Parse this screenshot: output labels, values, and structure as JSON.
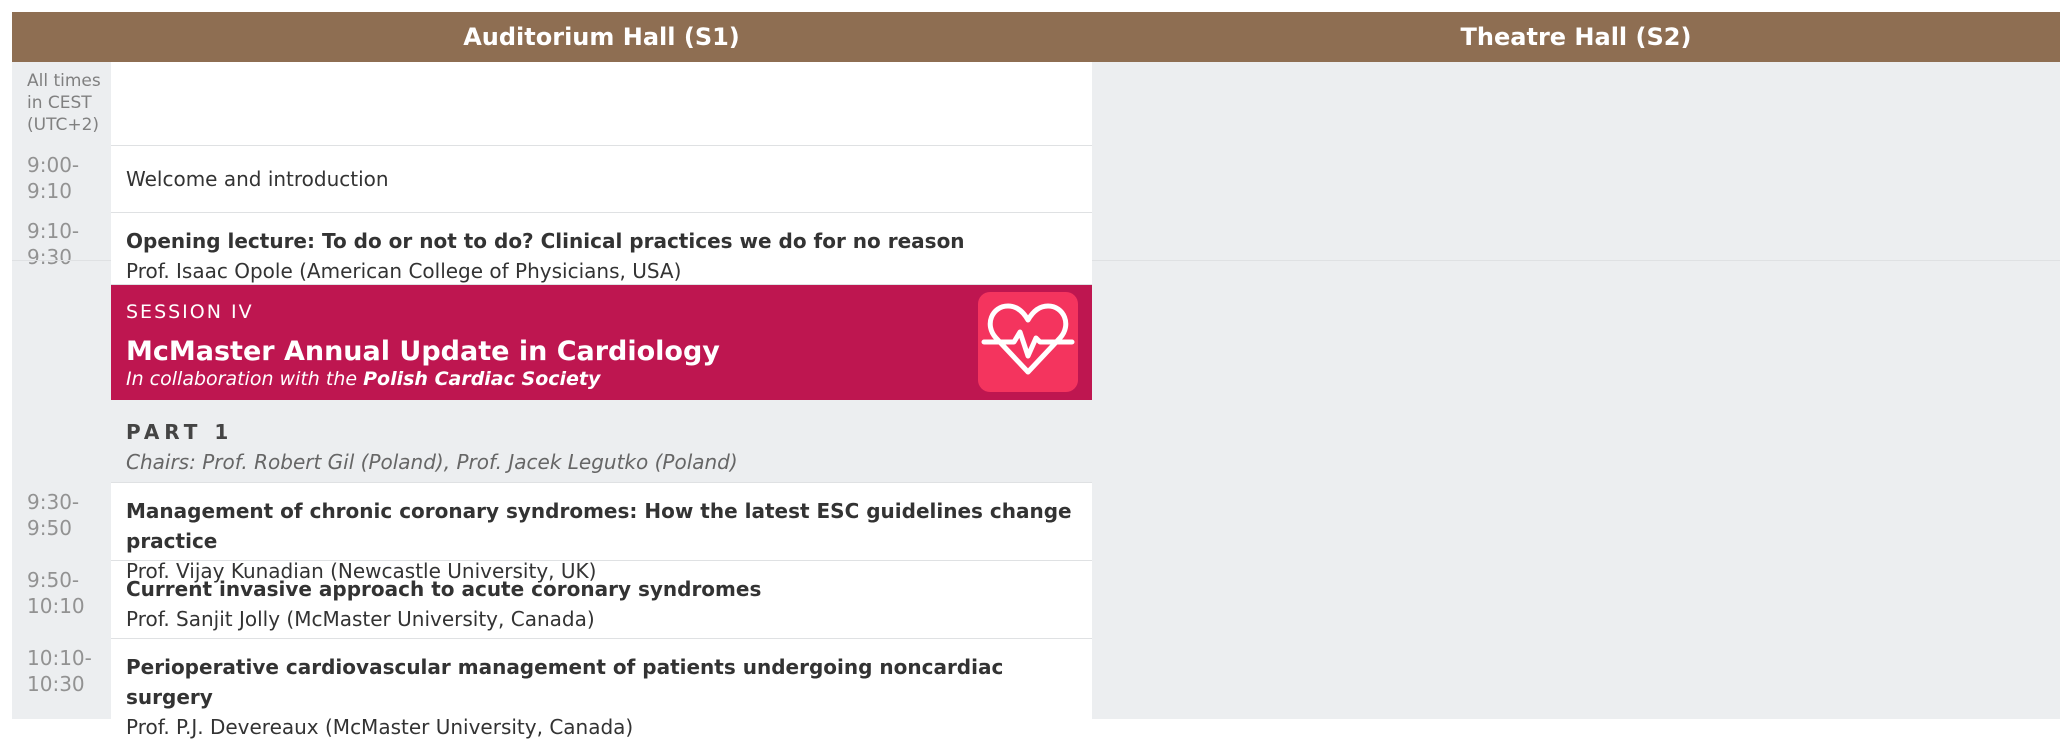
{
  "halls": {
    "s1": "Auditorium Hall (S1)",
    "s2": "Theatre Hall (S2)"
  },
  "timezone_note": "All times in CEST (UTC+2)",
  "times": {
    "welcome": "9:00-\n9:10",
    "opening": "9:10-\n9:30",
    "talk1": "9:30-\n9:50",
    "talk2": "9:50-\n10:10",
    "talk3": "10:10-\n10:30"
  },
  "welcome": "Welcome and introduction",
  "opening": {
    "title": "Opening lecture: To do or not to do? Clinical practices we do for no reason",
    "speaker": "Prof. Isaac Opole (American College of Physicians, USA)"
  },
  "session": {
    "label": "SESSION IV",
    "title": "McMaster Annual Update in Cardiology",
    "subtitle_prefix": "In collaboration with the",
    "subtitle_org": "Polish Cardiac Society",
    "logo_icon": "heart-pulse-icon",
    "color": "#be1650"
  },
  "part": {
    "label": "PART 1",
    "chairs": "Chairs: Prof. Robert Gil (Poland), Prof. Jacek Legutko (Poland)"
  },
  "talks": [
    {
      "title": "Management of chronic coronary syndromes: How the latest ESC guidelines change practice",
      "speaker": "Prof. Vijay Kunadian (Newcastle University, UK)"
    },
    {
      "title": "Current invasive approach to acute coronary syndromes",
      "speaker": "Prof. Sanjit Jolly (McMaster University, Canada)"
    },
    {
      "title": "Perioperative cardiovascular management of patients undergoing noncardiac surgery",
      "speaker": "Prof. P.J. Devereaux (McMaster University, Canada)"
    }
  ]
}
